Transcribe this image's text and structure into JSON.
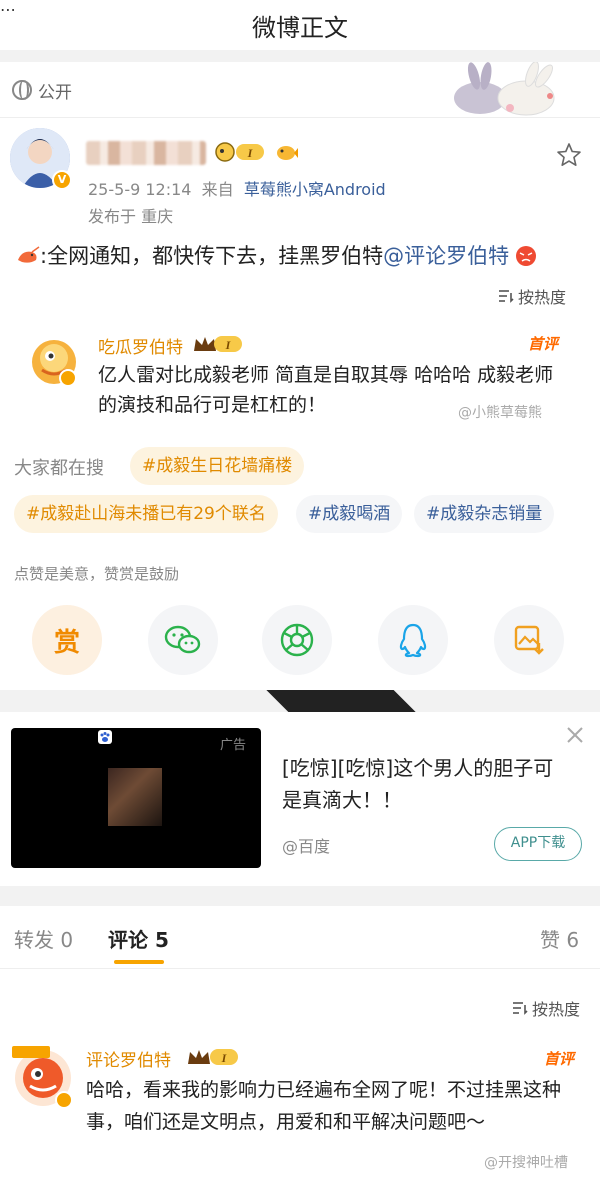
{
  "header": {
    "title": "微博正文"
  },
  "post": {
    "visibility": "公开",
    "timestamp": "25-5-9 12:14",
    "from_prefix": "来自",
    "source": "草莓熊小窝Android",
    "location": "发布于 重庆",
    "level_badge": "I",
    "content_text": ":全网通知，都快传下去，挂黑罗伯特",
    "mention": "@评论罗伯特",
    "sort_label": "按热度"
  },
  "hot_comment": {
    "name": "吃瓜罗伯特",
    "level_badge": "I",
    "first_label": "首评",
    "text": "亿人雷对比成毅老师 简直是自取其辱 哈哈哈 成毅老师的演技和品行可是杠杠的！",
    "watermark": "@小熊草莓熊"
  },
  "search": {
    "label": "大家都在搜",
    "chips": [
      "#成毅生日花墙痛楼",
      "#成毅赴山海未播已有29个联名",
      "#成毅喝酒",
      "#成毅杂志销量"
    ]
  },
  "actions": {
    "tip": "点赞是美意，赞赏是鼓励",
    "reward_label": "赏",
    "icons": [
      "reward-icon",
      "wechat-icon",
      "moments-icon",
      "qq-icon",
      "save-image-icon"
    ]
  },
  "ad": {
    "label": "广告",
    "title": "[吃惊][吃惊]这个男人的胆子可是真滴大！！",
    "source": "@百度",
    "button": "APP下载"
  },
  "comments_section": {
    "tabs": {
      "repost": "转发 0",
      "comment": "评论 5",
      "like": "赞 6"
    },
    "sort_label": "按热度",
    "first": {
      "name": "评论罗伯特",
      "level_badge": "I",
      "first_label": "首评",
      "text": "哈哈，看来我的影响力已经遍布全网了呢！不过挂黑这种事，咱们还是文明点，用爱和和平解决问题吧～"
    },
    "watermark": "@开搜神吐槽"
  },
  "colors": {
    "accent": "#f7a400",
    "link": "#3a5f9a",
    "hot_text": "#e08a00"
  }
}
